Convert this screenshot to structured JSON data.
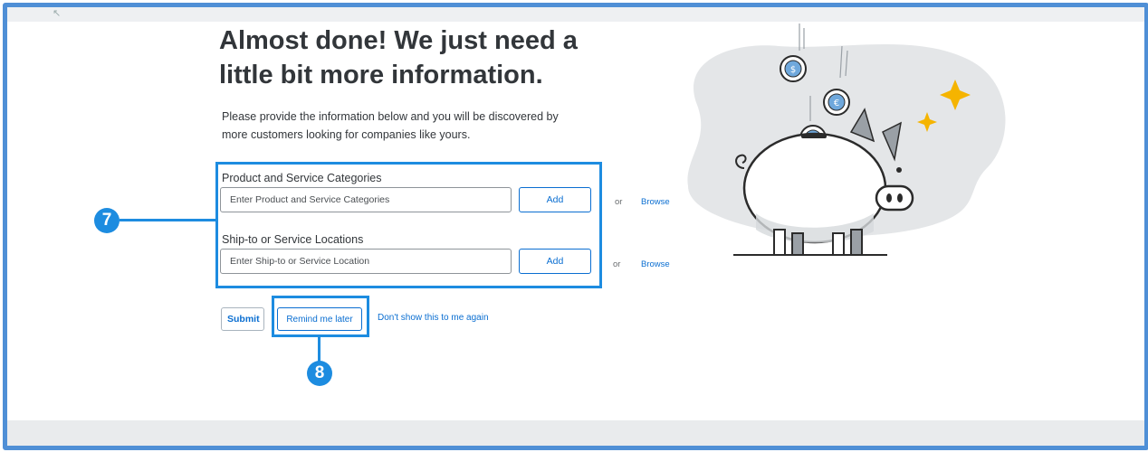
{
  "page": {
    "heading": "Almost done! We just need a little bit more information.",
    "description": "Please provide the information below and you will be discovered by more customers looking for companies like yours."
  },
  "categories": {
    "label": "Product and Service Categories",
    "placeholder": "Enter Product and Service Categories",
    "add_label": "Add",
    "or_text": "or",
    "browse_label": "Browse"
  },
  "locations": {
    "label": "Ship-to or Service Locations",
    "placeholder": "Enter Ship-to or Service Location",
    "add_label": "Add",
    "or_text": "or",
    "browse_label": "Browse"
  },
  "actions": {
    "submit_label": "Submit",
    "remind_label": "Remind me later",
    "dont_show_label": "Don't show this to me again"
  },
  "callouts": {
    "step_7": "7",
    "step_8": "8"
  },
  "colors": {
    "callout_blue": "#1d8ce0",
    "link_blue": "#0a6ed1",
    "frame_blue": "#4f8fd6",
    "sparkle_gold": "#f5b400"
  },
  "illustration": {
    "name": "piggy-bank-with-coins"
  }
}
